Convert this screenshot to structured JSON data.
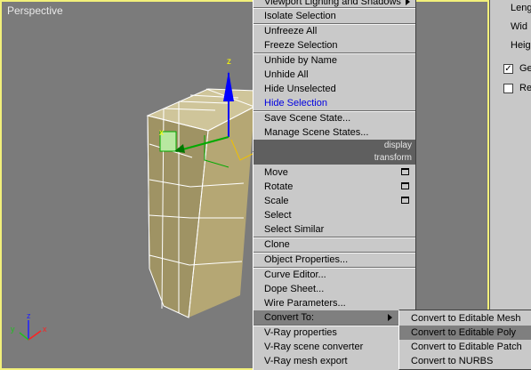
{
  "viewport": {
    "label": "Perspective",
    "gizmo_axis": {
      "z": "z",
      "x": "x"
    },
    "corner_axis": {
      "z": "z",
      "y": "y",
      "x": "x"
    }
  },
  "right_panel": {
    "labels": [
      "Leng",
      "Wid",
      "Heig"
    ],
    "checkboxes": [
      {
        "label": "Ge",
        "checked": true,
        "mark": "✓"
      },
      {
        "label": "Re",
        "checked": false,
        "mark": ""
      }
    ]
  },
  "menu_top": {
    "items": [
      {
        "label": "Viewport Lighting and Shadows",
        "has_submenu": true
      },
      {
        "label": "Isolate Selection"
      },
      {
        "label": "Unfreeze All"
      },
      {
        "label": "Freeze Selection"
      },
      {
        "label": "Unhide by Name"
      },
      {
        "label": "Unhide All"
      },
      {
        "label": "Hide Unselected"
      },
      {
        "label": "Hide Selection",
        "color": "#0000e0"
      },
      {
        "label": "Save Scene State..."
      },
      {
        "label": "Manage Scene States..."
      }
    ],
    "header": "display"
  },
  "menu_bottom": {
    "header": "transform",
    "items": [
      {
        "label": "Move"
      },
      {
        "label": "Rotate"
      },
      {
        "label": "Scale"
      },
      {
        "label": "Select"
      },
      {
        "label": "Select Similar"
      },
      {
        "label": "Clone"
      },
      {
        "label": "Object Properties..."
      },
      {
        "label": "Curve Editor..."
      },
      {
        "label": "Dope Sheet..."
      },
      {
        "label": "Wire Parameters..."
      },
      {
        "label": "Convert To:"
      },
      {
        "label": "V-Ray properties"
      },
      {
        "label": "V-Ray scene converter"
      },
      {
        "label": "V-Ray mesh export"
      }
    ]
  },
  "submenu": {
    "items": [
      {
        "label": "Convert to Editable Mesh"
      },
      {
        "label": "Convert to Editable Poly",
        "highlighted": true
      },
      {
        "label": "Convert to Editable Patch"
      },
      {
        "label": "Convert to NURBS"
      }
    ]
  },
  "colors": {
    "viewport_bg": "#7b7b7b",
    "viewport_border": "#f2f07a",
    "menu_bg": "#c9c9c9",
    "highlight": "#7f7f7f",
    "header_bg": "#5f5f5f",
    "object_face": "#b5a774",
    "gizmo_z": "#0000ff",
    "gizmo_x": "#00aa00"
  }
}
